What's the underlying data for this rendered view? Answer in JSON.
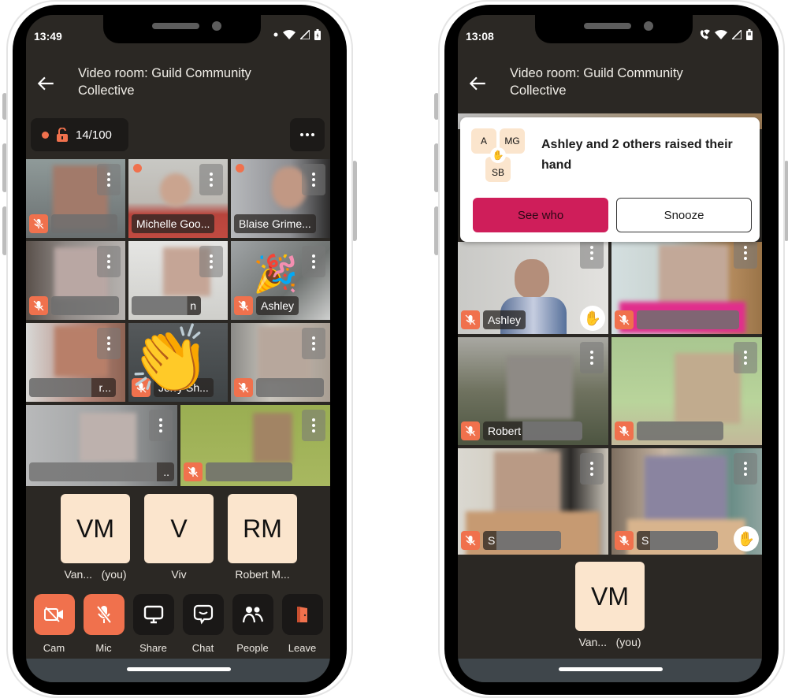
{
  "phones": [
    {
      "status": {
        "time": "13:49",
        "icons": [
          "dot-icon",
          "wifi-icon",
          "signal-icon",
          "battery-charging-icon"
        ]
      },
      "appbar": {
        "title": "Video room: Guild Community Collective"
      },
      "room_info": {
        "recording": true,
        "locked": false,
        "participants": "14/100"
      },
      "tiles": [
        {
          "name": "",
          "redacted": true,
          "muted": true,
          "recording": false
        },
        {
          "name": "Michelle Goo...",
          "redacted": false,
          "muted": false,
          "recording": true
        },
        {
          "name": "Blaise Grime...",
          "redacted": false,
          "muted": false,
          "recording": true
        },
        {
          "name": "",
          "redacted": true,
          "muted": true,
          "recording": false
        },
        {
          "name": "n",
          "redacted": true,
          "muted": false,
          "recording": false
        },
        {
          "name": "Ashley",
          "redacted": false,
          "muted": true,
          "recording": false,
          "reaction": "party-popper"
        },
        {
          "name": "r...",
          "redacted": true,
          "muted": false,
          "recording": false
        },
        {
          "name": "Jerry Sh...",
          "redacted": false,
          "muted": true,
          "recording": false,
          "reaction": "clapping-hands"
        },
        {
          "name": "",
          "redacted": true,
          "muted": true,
          "recording": false
        },
        {
          "name": "..",
          "redacted": true,
          "muted": false,
          "recording": false
        },
        {
          "name": "",
          "redacted": true,
          "muted": true,
          "recording": false
        }
      ],
      "avatars": [
        {
          "initials": "VM",
          "name": "Van...   (you)"
        },
        {
          "initials": "V",
          "name": "Viv"
        },
        {
          "initials": "RM",
          "name": "Robert M..."
        }
      ],
      "controls": [
        {
          "id": "cam",
          "label": "Cam",
          "active": true,
          "icon": "camera-off-icon"
        },
        {
          "id": "mic",
          "label": "Mic",
          "active": true,
          "icon": "mic-off-icon"
        },
        {
          "id": "share",
          "label": "Share",
          "active": false,
          "icon": "screen-share-icon"
        },
        {
          "id": "chat",
          "label": "Chat",
          "active": false,
          "icon": "chat-icon"
        },
        {
          "id": "people",
          "label": "People",
          "active": false,
          "icon": "people-icon"
        },
        {
          "id": "leave",
          "label": "Leave",
          "active": false,
          "icon": "leave-door-icon"
        }
      ]
    },
    {
      "status": {
        "time": "13:08",
        "icons": [
          "wifi-calling-icon",
          "wifi-icon",
          "signal-icon",
          "battery-icon"
        ]
      },
      "appbar": {
        "title": "Video room: Guild Community Collective"
      },
      "toast": {
        "avatars": [
          "A",
          "MG",
          "SB"
        ],
        "message": "Ashley and 2 others raised their hand",
        "primary_label": "See who",
        "secondary_label": "Snooze"
      },
      "tiles": [
        {
          "name": "Ashley",
          "redacted": false,
          "muted": true,
          "hand_raised": true
        },
        {
          "name": "",
          "redacted": true,
          "muted": true,
          "hand_raised": false
        },
        {
          "name": "Robert",
          "redacted": true,
          "muted": true,
          "hand_raised": false
        },
        {
          "name": "",
          "redacted": true,
          "muted": true,
          "hand_raised": false
        },
        {
          "name": "S",
          "redacted": true,
          "muted": true,
          "hand_raised": false
        },
        {
          "name": "S",
          "redacted": true,
          "muted": true,
          "hand_raised": true
        }
      ],
      "avatars": [
        {
          "initials": "VM",
          "name": "Van...   (you)"
        }
      ]
    }
  ],
  "colors": {
    "background": "#2b2824",
    "accent_orange": "#f0714d",
    "avatar_bg": "#fbe5cd",
    "primary_pink": "#cf1e5a"
  }
}
